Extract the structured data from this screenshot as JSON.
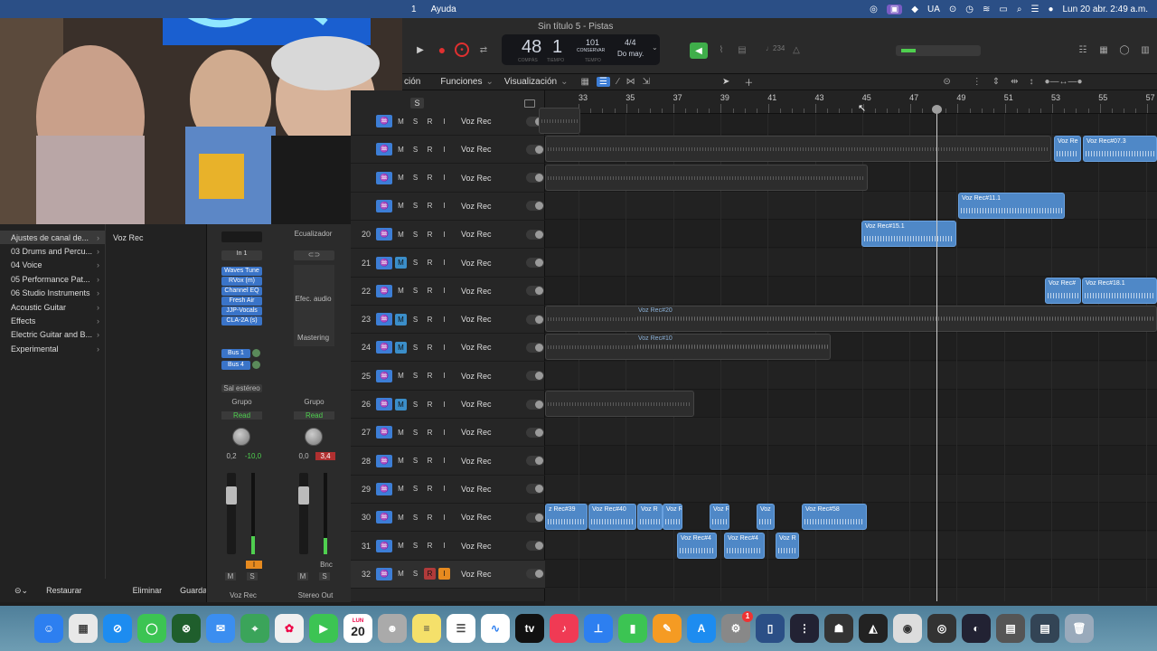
{
  "menubar": {
    "items": [
      "1",
      "Ayuda"
    ],
    "status": [
      "UA"
    ],
    "datetime": "Lun 20 abr.  2:49 a.m."
  },
  "window": {
    "title": "Sin título 5 - Pistas"
  },
  "transport": {
    "bar": "48",
    "beat": "1",
    "bar_label": "COMPÁS",
    "beat_label": "TIEMPO",
    "tempo": "101",
    "tempo_mode": "CONSERVAR",
    "tempo_label": "TEMPO",
    "signature": "4/4",
    "key": "Do may.",
    "count_in": "♩234"
  },
  "subbar": {
    "items": [
      "ción",
      "Funciones",
      "Visualización"
    ]
  },
  "ruler": {
    "bars": [
      "33",
      "35",
      "37",
      "39",
      "41",
      "43",
      "45",
      "47",
      "49",
      "51",
      "53",
      "55",
      "57"
    ]
  },
  "header_s": "S",
  "tracks": [
    {
      "num": "",
      "name": "Voz Rec",
      "m": false,
      "r": false,
      "i": false
    },
    {
      "num": "",
      "name": "Voz Rec",
      "m": false,
      "r": false,
      "i": false
    },
    {
      "num": "",
      "name": "Voz Rec",
      "m": false,
      "r": false,
      "i": false
    },
    {
      "num": "",
      "name": "Voz Rec",
      "m": false,
      "r": false,
      "i": false
    },
    {
      "num": "20",
      "name": "Voz Rec",
      "m": false,
      "r": false,
      "i": false
    },
    {
      "num": "21",
      "name": "Voz Rec",
      "m": true,
      "r": false,
      "i": false
    },
    {
      "num": "22",
      "name": "Voz Rec",
      "m": false,
      "r": false,
      "i": false
    },
    {
      "num": "23",
      "name": "Voz Rec",
      "m": true,
      "r": false,
      "i": false
    },
    {
      "num": "24",
      "name": "Voz Rec",
      "m": true,
      "r": false,
      "i": false
    },
    {
      "num": "25",
      "name": "Voz Rec",
      "m": false,
      "r": false,
      "i": false
    },
    {
      "num": "26",
      "name": "Voz Rec",
      "m": true,
      "r": false,
      "i": false
    },
    {
      "num": "27",
      "name": "Voz Rec",
      "m": false,
      "r": false,
      "i": false
    },
    {
      "num": "28",
      "name": "Voz Rec",
      "m": false,
      "r": false,
      "i": false
    },
    {
      "num": "29",
      "name": "Voz Rec",
      "m": false,
      "r": false,
      "i": false
    },
    {
      "num": "30",
      "name": "Voz Rec",
      "m": false,
      "r": false,
      "i": false
    },
    {
      "num": "31",
      "name": "Voz Rec",
      "m": false,
      "r": false,
      "i": false
    },
    {
      "num": "32",
      "name": "Voz Rec",
      "m": false,
      "r": true,
      "i": true
    }
  ],
  "track_buttons": {
    "m": "M",
    "s": "S",
    "r": "R",
    "i": "I"
  },
  "regions": [
    {
      "lane": 1,
      "name": "Voz Re",
      "style": "blue"
    },
    {
      "lane": 1,
      "name": "Voz Rec#07.3",
      "style": "blue"
    },
    {
      "lane": 3,
      "name": "Voz Rec#11.1",
      "style": "blue"
    },
    {
      "lane": 4,
      "name": "Voz Rec#15.1",
      "style": "blue"
    },
    {
      "lane": 6,
      "name": "Voz Rec#",
      "style": "blue"
    },
    {
      "lane": 6,
      "name": "Voz Rec#18.1",
      "style": "blue"
    },
    {
      "lane": 7,
      "name": "Voz Rec#20",
      "style": "gray"
    },
    {
      "lane": 8,
      "name": "Voz Rec#10",
      "style": "gray"
    },
    {
      "lane": 14,
      "name": "z Rec#39",
      "style": "blue"
    },
    {
      "lane": 14,
      "name": "Voz Rec#40",
      "style": "blue"
    },
    {
      "lane": 14,
      "name": "Voz R",
      "style": "blue"
    },
    {
      "lane": 14,
      "name": "Voz R",
      "style": "blue"
    },
    {
      "lane": 14,
      "name": "Voz R",
      "style": "blue"
    },
    {
      "lane": 14,
      "name": "Voz",
      "style": "blue"
    },
    {
      "lane": 14,
      "name": "Voz Rec#58",
      "style": "blue"
    },
    {
      "lane": 15,
      "name": "Voz Rec#4",
      "style": "blue"
    },
    {
      "lane": 15,
      "name": "Voz Rec#4",
      "style": "blue"
    },
    {
      "lane": 15,
      "name": "Voz R",
      "style": "blue"
    }
  ],
  "browser": {
    "items": [
      "Ajustes de canal de...",
      "03 Drums and Percu...",
      "04 Voice",
      "05 Performance Pat...",
      "06 Studio Instruments",
      "Acoustic Guitar",
      "Effects",
      "Electric Guitar and B...",
      "Experimental"
    ],
    "selected_value": "Voz Rec",
    "restore": "Restaurar",
    "delete": "Eliminar",
    "save": "Guardar..."
  },
  "mixer": {
    "strip1": {
      "input": "In 1",
      "plugins": [
        "Waves Tune",
        "RVox (m)",
        "Channel EQ",
        "Fresh Air",
        "JJP-Vocals",
        "CLA-2A (s)"
      ],
      "sends": [
        "Bus 1",
        "Bus 4"
      ],
      "output": "Sal estéreo",
      "group": "Grupo",
      "automation": "Read",
      "pan": "0,2",
      "peak": "-10,0",
      "name": "Voz Rec"
    },
    "strip2": {
      "eq": "Ecualizador",
      "fx": "Efec. audio",
      "mastering": "Mastering",
      "group": "Grupo",
      "automation": "Read",
      "pan": "0,0",
      "peak": "3,4",
      "bnc": "Bnc",
      "name": "Stereo Out"
    }
  },
  "dock": {
    "calendar_month": "LUN",
    "calendar_day": "20",
    "badge": "1"
  }
}
